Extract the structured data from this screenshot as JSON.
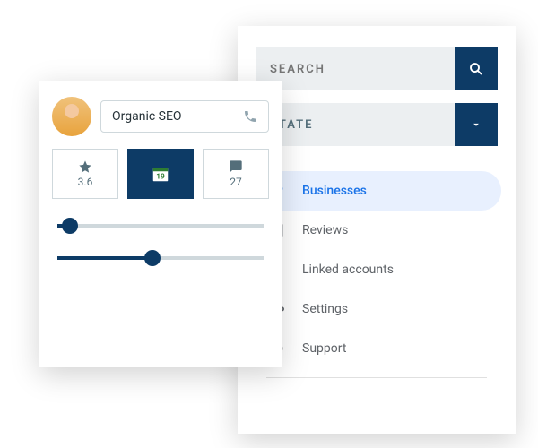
{
  "search": {
    "placeholder": "SEARCH"
  },
  "state": {
    "label": "STATE"
  },
  "menu": {
    "items": [
      {
        "label": "Businesses",
        "active": true
      },
      {
        "label": "Reviews"
      },
      {
        "label": "Linked accounts"
      },
      {
        "label": "Settings"
      },
      {
        "label": "Support"
      }
    ]
  },
  "profile": {
    "title": "Organic SEO"
  },
  "stats": {
    "rating": "3.6",
    "calendar": "19",
    "comments": "27"
  },
  "sliders": [
    {
      "percent": 6
    },
    {
      "percent": 46
    }
  ],
  "colors": {
    "accent": "#0d3b66",
    "menuActive": "#1a73e8"
  }
}
